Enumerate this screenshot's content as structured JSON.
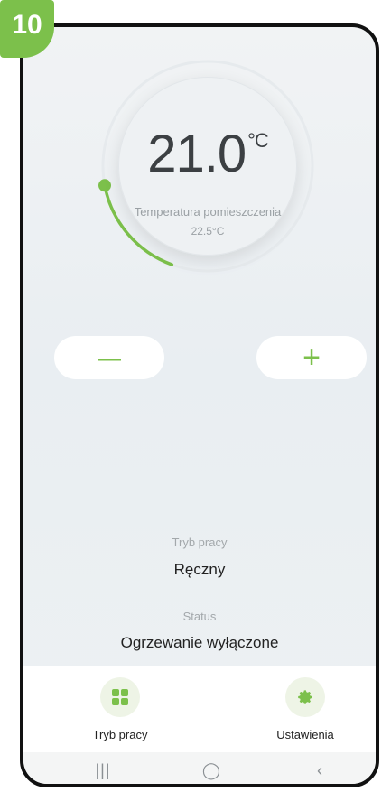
{
  "step_badge": "10",
  "thermostat": {
    "set_temperature": "21.0",
    "unit": "°C",
    "room_label": "Temperatura pomieszczenia",
    "room_temperature": "22.5°C",
    "arc_fill_fraction": 0.22
  },
  "controls": {
    "decrease_label": "—",
    "increase_label": "+"
  },
  "mode": {
    "label": "Tryb pracy",
    "value": "Ręczny"
  },
  "status": {
    "label": "Status",
    "value": "Ogrzewanie wyłączone"
  },
  "bottom_nav": {
    "items": [
      {
        "label": "Tryb pracy",
        "icon": "grid-icon"
      },
      {
        "label": "Ustawienia",
        "icon": "gear-icon"
      }
    ]
  },
  "system_nav": {
    "recent": "|||",
    "home": "◯",
    "back": "‹"
  },
  "colors": {
    "accent": "#7cc04b",
    "text": "#222222",
    "muted": "#a3a8ab"
  }
}
